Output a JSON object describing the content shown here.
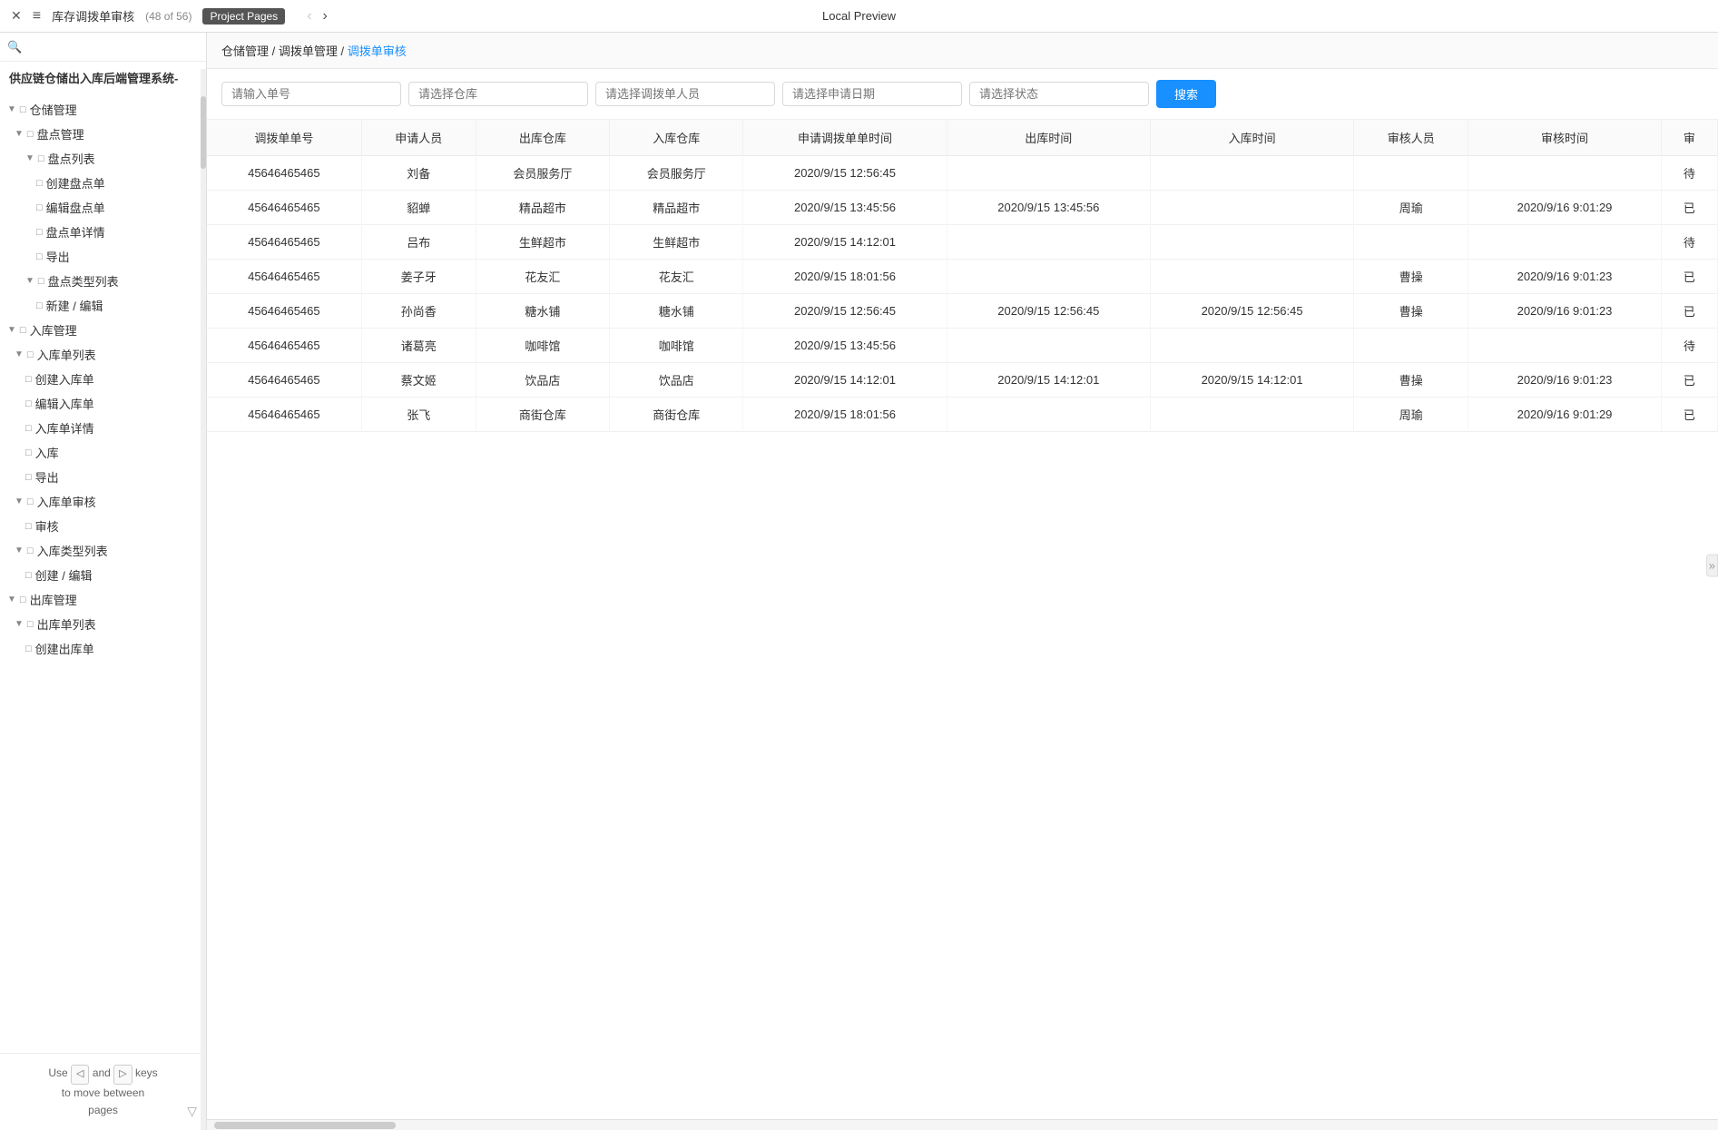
{
  "topBar": {
    "closeLabel": "✕",
    "menuIcon": "≡",
    "title": "库存调拨单审核",
    "count": "(48 of 56)",
    "centerTitle": "Local Preview",
    "projectPagesLabel": "Project Pages",
    "prevArrow": "‹",
    "nextArrow": "›"
  },
  "sidebar": {
    "searchPlaceholder": "🔍",
    "appTitle": "供应链仓储出入库后端管理系统-",
    "items": [
      {
        "id": "warehouse-mgmt",
        "label": "仓储管理",
        "level": 0,
        "expand": "▼",
        "icon": "□",
        "type": "group"
      },
      {
        "id": "inventory-mgmt",
        "label": "盘点管理",
        "level": 1,
        "expand": "▼",
        "icon": "□",
        "type": "group"
      },
      {
        "id": "inventory-list-group",
        "label": "盘点列表",
        "level": 2,
        "expand": "▼",
        "icon": "□",
        "type": "group"
      },
      {
        "id": "create-inventory",
        "label": "创建盘点单",
        "level": 3,
        "icon": "□",
        "type": "leaf"
      },
      {
        "id": "edit-inventory",
        "label": "编辑盘点单",
        "level": 3,
        "icon": "□",
        "type": "leaf"
      },
      {
        "id": "inventory-detail",
        "label": "盘点单详情",
        "level": 3,
        "icon": "□",
        "type": "leaf"
      },
      {
        "id": "export-inventory",
        "label": "导出",
        "level": 3,
        "icon": "□",
        "type": "leaf"
      },
      {
        "id": "inventory-type-group",
        "label": "盘点类型列表",
        "level": 2,
        "expand": "▼",
        "icon": "□",
        "type": "group"
      },
      {
        "id": "new-edit-type",
        "label": "新建 / 编辑",
        "level": 3,
        "icon": "□",
        "type": "leaf"
      },
      {
        "id": "inbound-mgmt",
        "label": "入库管理",
        "level": 0,
        "expand": "▼",
        "icon": "□",
        "type": "group"
      },
      {
        "id": "inbound-list-group",
        "label": "入库单列表",
        "level": 1,
        "expand": "▼",
        "icon": "□",
        "type": "group"
      },
      {
        "id": "create-inbound",
        "label": "创建入库单",
        "level": 2,
        "icon": "□",
        "type": "leaf"
      },
      {
        "id": "edit-inbound",
        "label": "编辑入库单",
        "level": 2,
        "icon": "□",
        "type": "leaf"
      },
      {
        "id": "inbound-detail",
        "label": "入库单详情",
        "level": 2,
        "icon": "□",
        "type": "leaf"
      },
      {
        "id": "inbound",
        "label": "入库",
        "level": 2,
        "icon": "□",
        "type": "leaf"
      },
      {
        "id": "export-inbound",
        "label": "导出",
        "level": 2,
        "icon": "□",
        "type": "leaf"
      },
      {
        "id": "inbound-audit-group",
        "label": "入库单审核",
        "level": 1,
        "expand": "▼",
        "icon": "□",
        "type": "group"
      },
      {
        "id": "audit",
        "label": "审核",
        "level": 2,
        "icon": "□",
        "type": "leaf"
      },
      {
        "id": "inbound-type-group",
        "label": "入库类型列表",
        "level": 1,
        "expand": "▼",
        "icon": "□",
        "type": "group"
      },
      {
        "id": "new-edit-inbound-type",
        "label": "创建 / 编辑",
        "level": 2,
        "icon": "□",
        "type": "leaf"
      },
      {
        "id": "outbound-mgmt",
        "label": "出库管理",
        "level": 0,
        "expand": "▼",
        "icon": "□",
        "type": "group"
      },
      {
        "id": "outbound-list-group",
        "label": "出库单列表",
        "level": 1,
        "expand": "▼",
        "icon": "□",
        "type": "group"
      },
      {
        "id": "create-outbound",
        "label": "创建出库单",
        "level": 2,
        "icon": "□",
        "type": "leaf"
      }
    ],
    "bottomHint": {
      "useLabel": "Use",
      "andLabel": "and",
      "keysLabel": "keys",
      "moveLabel": "to move between",
      "pagesLabel": "pages",
      "prevKey": "◁",
      "nextKey": "▷"
    }
  },
  "breadcrumb": {
    "part1": "仓储管理",
    "sep1": "/",
    "part2": "调拨单管理",
    "sep2": "/",
    "part3": "调拨单审核"
  },
  "filters": {
    "orderNoPlaceholder": "请输入单号",
    "warehousePlaceholder": "请选择仓库",
    "staffPlaceholder": "请选择调拨单人员",
    "datePlaceholder": "请选择申请日期",
    "statusPlaceholder": "请选择状态",
    "searchLabel": "搜索"
  },
  "table": {
    "headers": [
      "调拨单单号",
      "申请人员",
      "出库仓库",
      "入库仓库",
      "申请调拨单单时间",
      "出库时间",
      "入库时间",
      "审核人员",
      "审核时间",
      "审"
    ],
    "rows": [
      {
        "orderNo": "45646465465",
        "applicant": "刘备",
        "outWarehouse": "会员服务厅",
        "inWarehouse": "会员服务厅",
        "applyTime": "2020/9/15 12:56:45",
        "outTime": "",
        "inTime": "",
        "auditor": "",
        "auditTime": "",
        "status": "待"
      },
      {
        "orderNo": "45646465465",
        "applicant": "貂蝉",
        "outWarehouse": "精品超市",
        "inWarehouse": "精品超市",
        "applyTime": "2020/9/15 13:45:56",
        "outTime": "2020/9/15 13:45:56",
        "inTime": "",
        "auditor": "周瑜",
        "auditTime": "2020/9/16 9:01:29",
        "status": "已"
      },
      {
        "orderNo": "45646465465",
        "applicant": "吕布",
        "outWarehouse": "生鲜超市",
        "inWarehouse": "生鲜超市",
        "applyTime": "2020/9/15 14:12:01",
        "outTime": "",
        "inTime": "",
        "auditor": "",
        "auditTime": "",
        "status": "待"
      },
      {
        "orderNo": "45646465465",
        "applicant": "姜子牙",
        "outWarehouse": "花友汇",
        "inWarehouse": "花友汇",
        "applyTime": "2020/9/15 18:01:56",
        "outTime": "",
        "inTime": "",
        "auditor": "曹操",
        "auditTime": "2020/9/16 9:01:23",
        "status": "已"
      },
      {
        "orderNo": "45646465465",
        "applicant": "孙尚香",
        "outWarehouse": "糖水铺",
        "inWarehouse": "糖水铺",
        "applyTime": "2020/9/15 12:56:45",
        "outTime": "2020/9/15 12:56:45",
        "inTime": "2020/9/15 12:56:45",
        "auditor": "曹操",
        "auditTime": "2020/9/16 9:01:23",
        "status": "已"
      },
      {
        "orderNo": "45646465465",
        "applicant": "诸葛亮",
        "outWarehouse": "咖啡馆",
        "inWarehouse": "咖啡馆",
        "applyTime": "2020/9/15 13:45:56",
        "outTime": "",
        "inTime": "",
        "auditor": "",
        "auditTime": "",
        "status": "待"
      },
      {
        "orderNo": "45646465465",
        "applicant": "蔡文姬",
        "outWarehouse": "饮品店",
        "inWarehouse": "饮品店",
        "applyTime": "2020/9/15 14:12:01",
        "outTime": "2020/9/15 14:12:01",
        "inTime": "2020/9/15 14:12:01",
        "auditor": "曹操",
        "auditTime": "2020/9/16 9:01:23",
        "status": "已"
      },
      {
        "orderNo": "45646465465",
        "applicant": "张飞",
        "outWarehouse": "商街仓库",
        "inWarehouse": "商街仓库",
        "applyTime": "2020/9/15 18:01:56",
        "outTime": "",
        "inTime": "",
        "auditor": "周瑜",
        "auditTime": "2020/9/16 9:01:29",
        "status": "已"
      }
    ]
  }
}
